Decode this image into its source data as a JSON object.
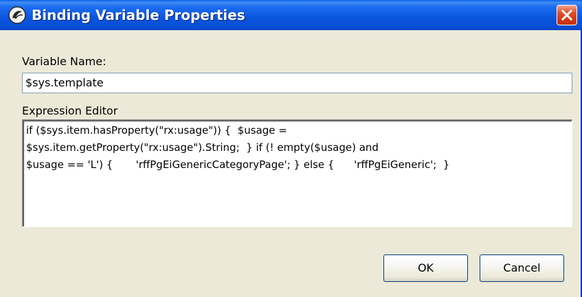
{
  "window": {
    "title": "Binding Variable Properties",
    "icons": {
      "app": "percussion-app-icon",
      "close": "close-icon"
    }
  },
  "form": {
    "variable_name_label": "Variable Name:",
    "variable_name_value": "$sys.template",
    "expression_label": "Expression Editor",
    "expression_value": "if ($sys.item.hasProperty(\"rx:usage\")) {  $usage = \n$sys.item.getProperty(\"rx:usage\").String;  } if (! empty($usage) and \n$usage == 'L') {       'rffPgEiGenericCategoryPage'; } else {      'rffPgEiGeneric';  }"
  },
  "buttons": {
    "ok_label": "OK",
    "cancel_label": "Cancel"
  },
  "colors": {
    "titlebar": "#0a55dd",
    "window_bg": "#ece9d8",
    "close_button": "#d23c14",
    "field_border": "#7f9db9"
  }
}
